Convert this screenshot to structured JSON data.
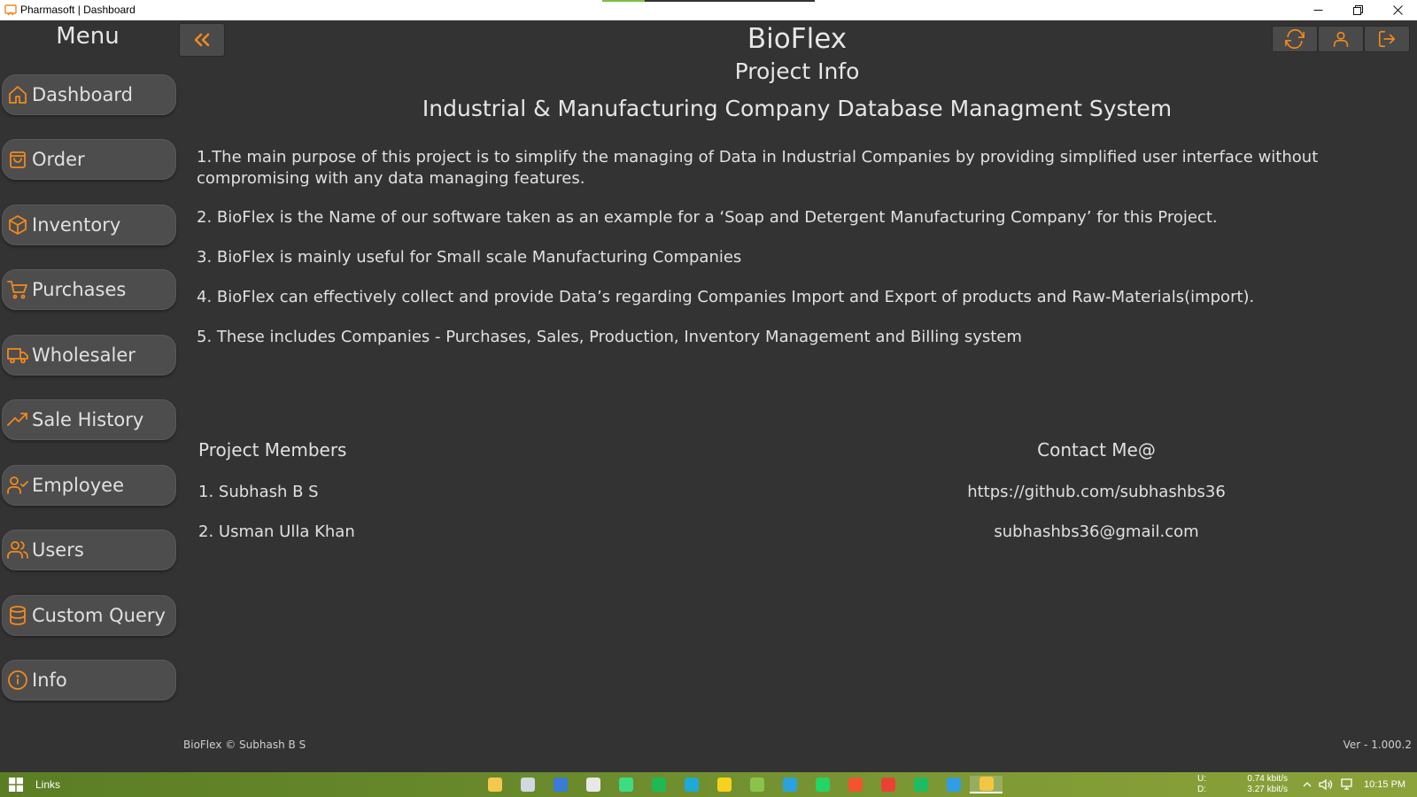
{
  "window": {
    "title": "Pharmasoft | Dashboard",
    "load_progress": 0.2
  },
  "sidebar": {
    "title": "Menu",
    "items": [
      {
        "label": "Dashboard",
        "icon": "home-icon"
      },
      {
        "label": "Order",
        "icon": "shopping-bag-icon"
      },
      {
        "label": "Inventory",
        "icon": "box-icon"
      },
      {
        "label": "Purchases",
        "icon": "cart-icon"
      },
      {
        "label": "Wholesaler",
        "icon": "truck-icon"
      },
      {
        "label": "Sale History",
        "icon": "trending-up-icon"
      },
      {
        "label": "Employee",
        "icon": "user-check-icon"
      },
      {
        "label": "Users",
        "icon": "users-icon"
      },
      {
        "label": "Custom Query",
        "icon": "database-icon"
      },
      {
        "label": "Info",
        "icon": "info-icon"
      }
    ]
  },
  "header": {
    "app_name": "BioFlex",
    "page_title": "Project Info"
  },
  "content": {
    "subtitle": "Industrial & Manufacturing Company Database Managment System",
    "points": [
      "1.The main purpose of this project is to simplify the managing of Data in Industrial Companies by providing simplified user interface without compromising with any data managing features.",
      "2. BioFlex is the Name of our software taken as an example for a ‘Soap and Detergent Manufacturing Company’ for this Project.",
      "3. BioFlex is mainly useful for Small scale Manufacturing Companies",
      "4. BioFlex can effectively collect and provide Data’s regarding Companies Import and Export of products and Raw-Materials(import).",
      "5. These includes Companies - Purchases, Sales, Production, Inventory Management  and Billing system"
    ],
    "members_heading": "Project Members",
    "members": [
      "1. Subhash B S",
      "2. Usman Ulla Khan"
    ],
    "contact_heading": "Contact Me@",
    "contacts": [
      "https://github.com/subhashbs36",
      "subhashbs36@gmail.com"
    ]
  },
  "footer": {
    "copyright": "BioFlex © Subhash B S",
    "version": "Ver - 1.000.2"
  },
  "taskbar": {
    "links_label": "Links",
    "upload_label": "U:",
    "download_label": "D:",
    "upload_rate": "0.74 kbit/s",
    "download_rate": "3.27 kbit/s",
    "time": "10:15 PM",
    "apps": [
      {
        "name": "file-explorer-icon",
        "color": "#f2c94c"
      },
      {
        "name": "box-app-icon",
        "color": "#d0d8e0"
      },
      {
        "name": "database-app-icon",
        "color": "#3a7bd5"
      },
      {
        "name": "store-icon",
        "color": "#e8e8e8"
      },
      {
        "name": "android-studio-icon",
        "color": "#3ddc84"
      },
      {
        "name": "spotify-icon",
        "color": "#1db954"
      },
      {
        "name": "edge-icon",
        "color": "#1fa9d6"
      },
      {
        "name": "sticky-notes-icon",
        "color": "#f7d11c"
      },
      {
        "name": "android-icon",
        "color": "#8bc34a"
      },
      {
        "name": "telegram-icon",
        "color": "#2aa3dc"
      },
      {
        "name": "whatsapp-icon",
        "color": "#25d366"
      },
      {
        "name": "brave-icon",
        "color": "#f2542d"
      },
      {
        "name": "chrome-icon",
        "color": "#e94235"
      },
      {
        "name": "dashlane-icon",
        "color": "#1ebc61"
      },
      {
        "name": "vscode-icon",
        "color": "#2f9ee6"
      },
      {
        "name": "python-app-icon",
        "color": "#f4c542"
      }
    ]
  },
  "colors": {
    "accent": "#f0891f",
    "background": "#333333",
    "button": "#4d4d4d"
  }
}
